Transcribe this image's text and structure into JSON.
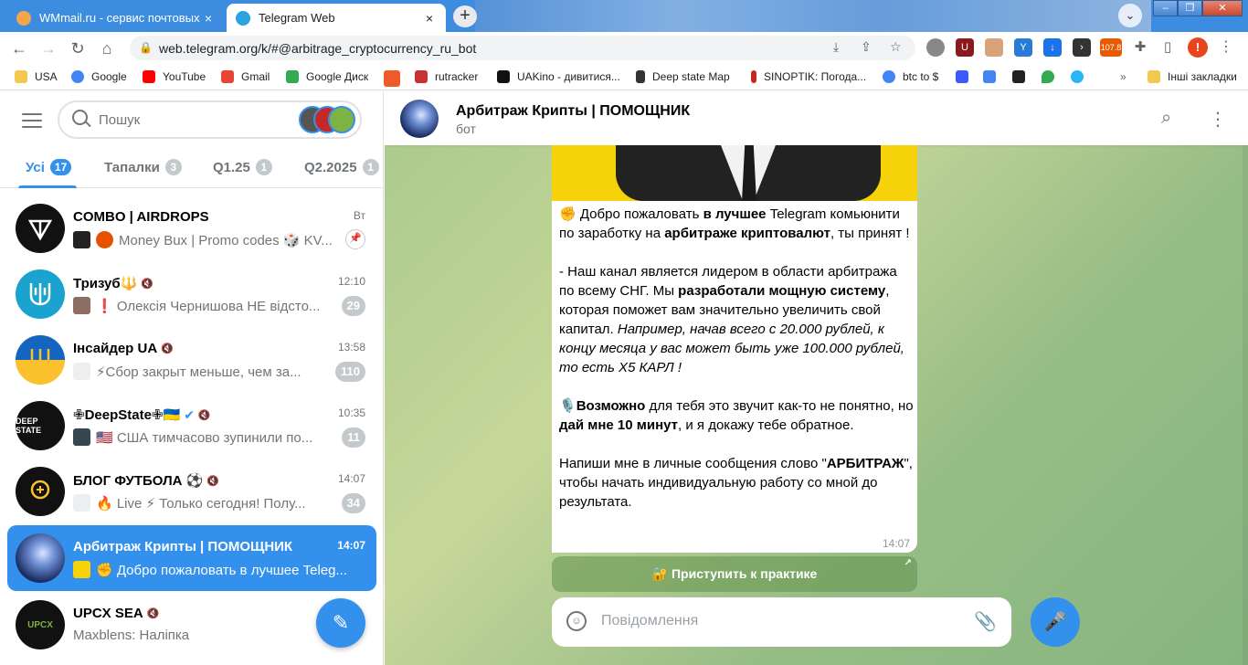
{
  "browser": {
    "tabs": [
      {
        "title": "WMmail.ru - сервис почтовых р",
        "close": "×"
      },
      {
        "title": "Telegram Web",
        "close": "×"
      }
    ],
    "new_tab": "+",
    "url": "web.telegram.org/k/#@arbitrage_cryptocurrency_ru_bot",
    "extension_badge": "107.8",
    "profile_letter": "!",
    "bookmarks": [
      "USA",
      "Google",
      "YouTube",
      "Gmail",
      "Google Диск",
      "rutracker",
      "UAKino - дивитися...",
      "Deep state Map",
      "SINOPTIK: Погода...",
      "btc to $",
      "Інші закладки"
    ],
    "more": "»"
  },
  "sidebar": {
    "search_placeholder": "Пошук",
    "folders": [
      {
        "label": "Усі",
        "count": "17"
      },
      {
        "label": "Тапалки",
        "count": "3"
      },
      {
        "label": "Q1.25",
        "count": "1"
      },
      {
        "label": "Q2.2025",
        "count": "1"
      }
    ],
    "chats": [
      {
        "name": "COMBO | AIRDROPS",
        "time": "Вт",
        "preview": "Money Bux | Promo codes 🎲 KV..."
      },
      {
        "name": "Тризуб🔱",
        "time": "12:10",
        "preview": "❗ Олексія Чернишова НЕ відсто...",
        "count": "29"
      },
      {
        "name": "Інсайдер UA",
        "time": "13:58",
        "preview": "⚡Сбор закрыт меньше, чем за...",
        "count": "110"
      },
      {
        "name": "✙DeepState✙🇺🇦",
        "time": "10:35",
        "preview": "🇺🇸 США тимчасово зупинили по...",
        "count": "11"
      },
      {
        "name": "БЛОГ ФУТБОЛА ⚽",
        "time": "14:07",
        "preview": "🔥 Live ⚡ Только сегодня! Полу...",
        "count": "34"
      },
      {
        "name": "Арбитраж Крипты | ПОМОЩНИК",
        "time": "14:07",
        "preview": "✊ Добро пожаловать в лучшее Teleg..."
      },
      {
        "name": "UPCX SEA",
        "time": "",
        "preview": "Maxblens: Наліпка"
      }
    ]
  },
  "conversation": {
    "title": "Арбитраж Крипты | ПОМОЩНИК",
    "subtitle": "бот",
    "message": {
      "p1_a": "✊ Добро пожаловать ",
      "p1_b": "в лучшее",
      "p1_c": " Telegram комьюнити по заработку на ",
      "p1_d": "арбитраже криптовалют",
      "p1_e": ", ты принят !",
      "p2_a": "- Наш канал является лидером в области арбитража по всему СНГ. Мы ",
      "p2_b": "разработали мощную систему",
      "p2_c": ", которая поможет вам значительно увеличить свой капитал. ",
      "p2_d": "Например, начав всего с 20.000 рублей, к концу месяца у вас может быть уже 100.000 рублей, то есть Х5 КАРЛ !",
      "p3_a": "🎙️",
      "p3_b": "Возможно",
      "p3_c": " для тебя это звучит как-то не понятно, но ",
      "p3_d": "дай мне 10 минут",
      "p3_e": ", и я докажу тебе обратное.",
      "p4_a": "Напиши мне в личные сообщения слово \"",
      "p4_b": "АРБИТРАЖ",
      "p4_c": "\", чтобы начать индивидуальную работу со мной до результата.",
      "time": "14:07"
    },
    "inline_button": "🔐 Приступить к практике",
    "composer_placeholder": "Повідомлення"
  },
  "colors": {
    "accent": "#3390ec",
    "chrome_blue": "#3c8de0"
  }
}
